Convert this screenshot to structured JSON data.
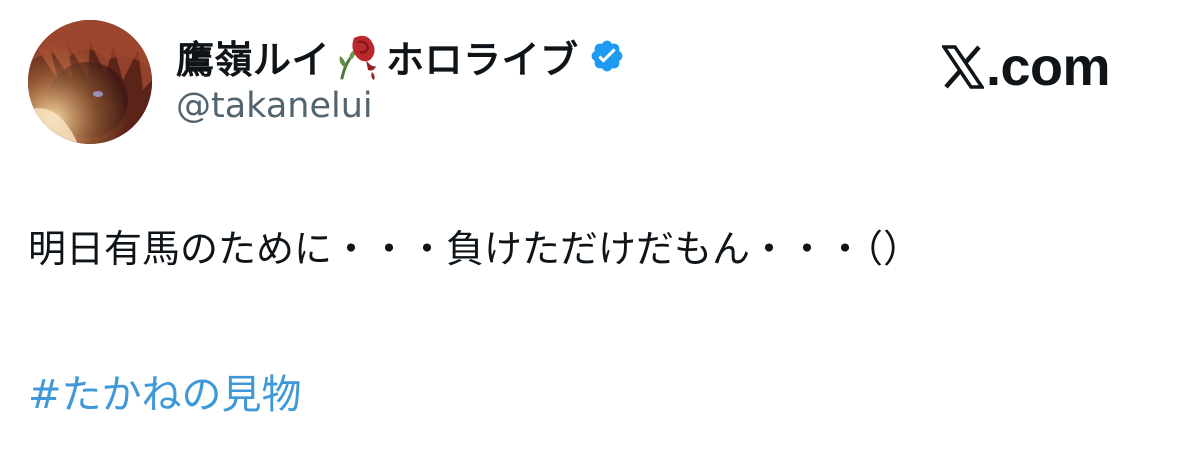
{
  "author": {
    "display_name_part1": "鷹嶺ルイ",
    "emoji_icon": "wilted-rose-icon",
    "display_name_part2": "ホロライブ",
    "verified_icon": "verified-badge-icon",
    "handle": "@takanelui"
  },
  "brand": {
    "logo_icon": "x-logo-icon",
    "domain_suffix": ".com"
  },
  "tweet": {
    "text": "明日有馬のために・・・負けただけだもん・・・（）",
    "hashtag": "#たかねの見物"
  },
  "colors": {
    "text": "#0f1419",
    "secondary": "#536471",
    "link": "#3f98d7",
    "verified": "#1d9bf0"
  }
}
